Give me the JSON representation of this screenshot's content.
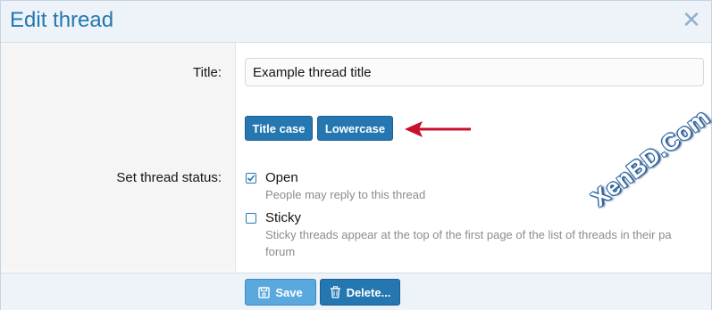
{
  "dialog": {
    "title": "Edit thread",
    "close_glyph": "✕",
    "close_icon": "close-icon"
  },
  "form": {
    "title_label": "Title:",
    "title_value": "Example thread title",
    "title_case_label": "Title case",
    "lowercase_label": "Lowercase",
    "status_label": "Set thread status:",
    "options": [
      {
        "label": "Open",
        "hint": "People may reply to this thread",
        "checked": true
      },
      {
        "label": "Sticky",
        "hint_line1": "Sticky threads appear at the top of the first page of the list of threads in their pa",
        "hint_line2": "forum",
        "checked": false
      }
    ]
  },
  "footer": {
    "save_label": "Save",
    "delete_label": "Delete..."
  },
  "annotation": {
    "arrow_color": "#c8102e",
    "arrow_icon": "left-arrow-icon"
  },
  "watermark": {
    "text": "XenBD.Com"
  },
  "colors": {
    "accent": "#2577b1",
    "header_bg": "#edf3f8",
    "footer_button": "#5aa8dd"
  }
}
